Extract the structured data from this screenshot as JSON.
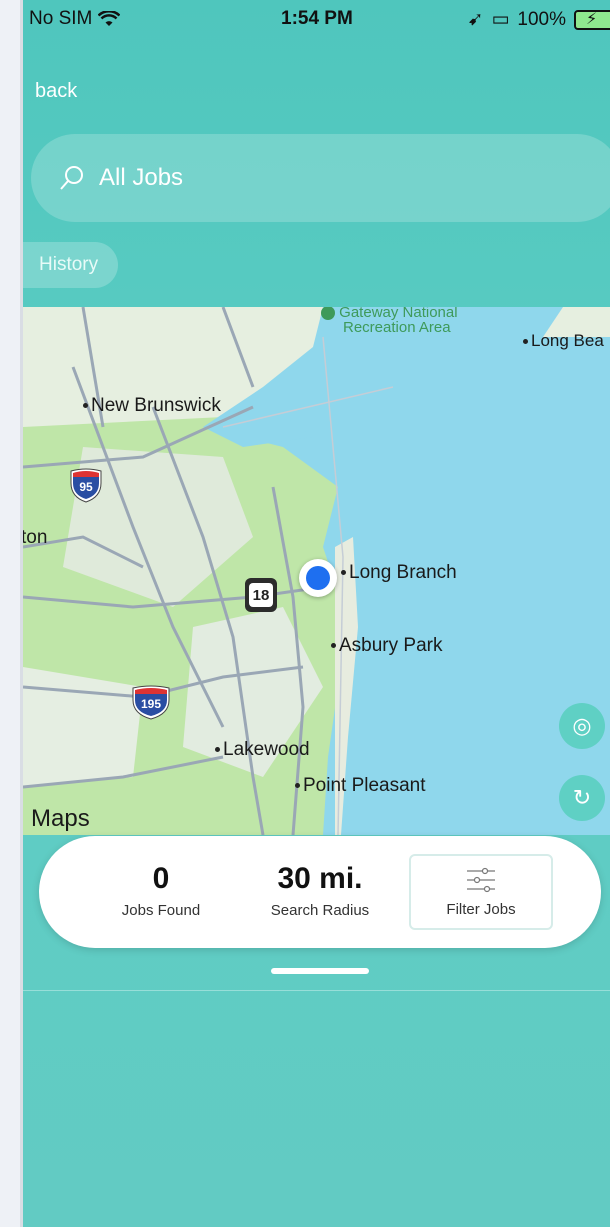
{
  "status_bar": {
    "carrier": "No SIM",
    "time": "1:54 PM",
    "battery": "100%"
  },
  "nav": {
    "back_label": "back"
  },
  "search": {
    "value": "All Jobs"
  },
  "history_label": "History",
  "map": {
    "labels": {
      "gateway": "Gateway National",
      "recreation": "Recreation Area",
      "long_beach": "Long Bea",
      "new_brunswick": "New Brunswick",
      "ton": "ton",
      "long_branch": "Long Branch",
      "asbury_park": "Asbury Park",
      "lakewood": "Lakewood",
      "point_pleasant": "Point Pleasant"
    },
    "shields": {
      "i95": "95",
      "r18": "18",
      "i195": "195"
    },
    "attribution": "Maps"
  },
  "stats": {
    "jobs_found_value": "0",
    "jobs_found_label": "Jobs Found",
    "radius_value": "30 mi.",
    "radius_label": "Search Radius",
    "filter_label": "Filter Jobs"
  },
  "colors": {
    "accent": "#5ccdc4",
    "water": "#8fd7ec",
    "land": "#bfe6a8",
    "user_location": "#1e6ff0"
  }
}
